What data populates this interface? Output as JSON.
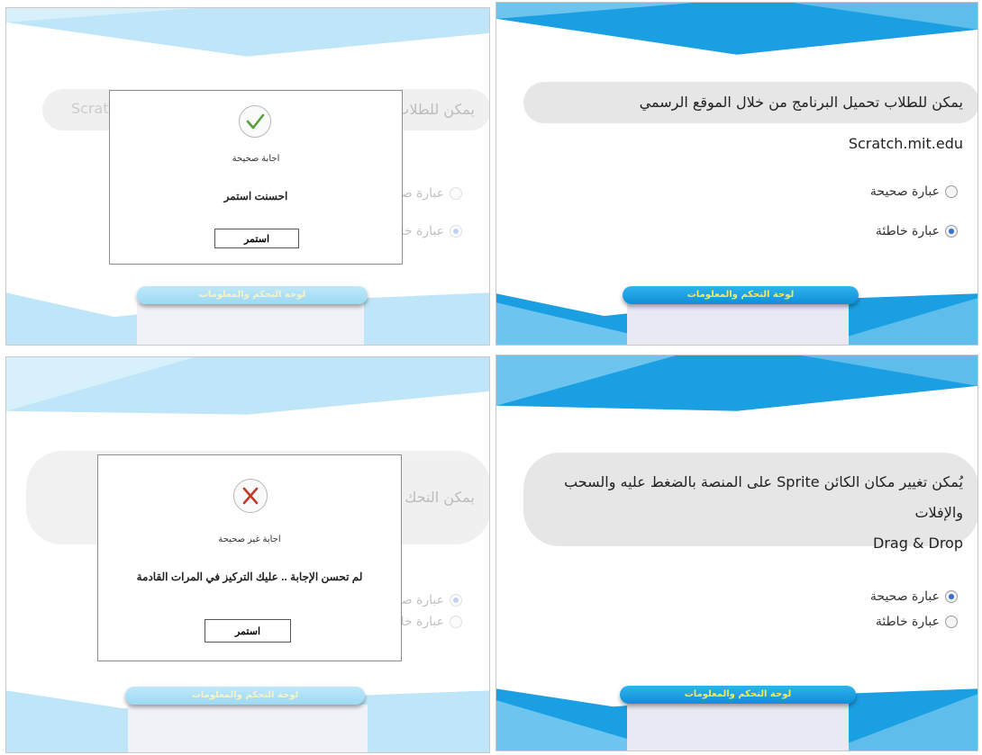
{
  "colors": {
    "blue_dark": "#1a9fe2",
    "blue_light": "#a9dcf4",
    "question_bg": "#e6e6e6",
    "tab_text_dark": "#ffe84a",
    "correct_green": "#5a9e38",
    "wrong_red": "#c0392b",
    "radio_selected": "#2f6fd0"
  },
  "screens": {
    "q1": {
      "question": "يمكن للطلاب تحميل البرنامج من خلال الموقع الرسمي Scratch.mit.edu",
      "option_true": "عبارة صحيحة",
      "option_false": "عبارة خاطئة",
      "selected": "false",
      "tab_label": "لوحة التحكم والمعلومات"
    },
    "q1_feedback": {
      "question_fragment_left": "Scrat",
      "question_fragment_right": "يمكن للطلاب",
      "option_true_fragment": "عبارة صحيحة",
      "option_false_fragment": "عبارة خاطئة",
      "selected": "false",
      "tab_label": "لوحة التحكم والمعلومات",
      "icon": "check-icon",
      "status": "اجابة صحيحة",
      "message": "احسنت استمر",
      "button": "استمر"
    },
    "q2": {
      "question_line1": "يُمكن تغيير مكان الكائن Sprite على المنصة بالضغط عليه والسحب والإفلات",
      "question_line2": "Drag & Drop",
      "option_true": "عبارة صحيحة",
      "option_false": "عبارة خاطئة",
      "selected": "true",
      "tab_label": "لوحة التحكم والمعلومات"
    },
    "q2_feedback": {
      "question_fragment_right": "يمكن التحك",
      "option_true_fragment": "عبارة صحيحة",
      "option_false_fragment": "عبارة خاطئة",
      "selected": "true",
      "tab_label": "لوحة التحكم والمعلومات",
      "icon": "x-icon",
      "status": "اجابة غير صحيحة",
      "message": "لم تحسن الإجابة .. عليك التركيز في المرات القادمة",
      "button": "استمر"
    }
  }
}
